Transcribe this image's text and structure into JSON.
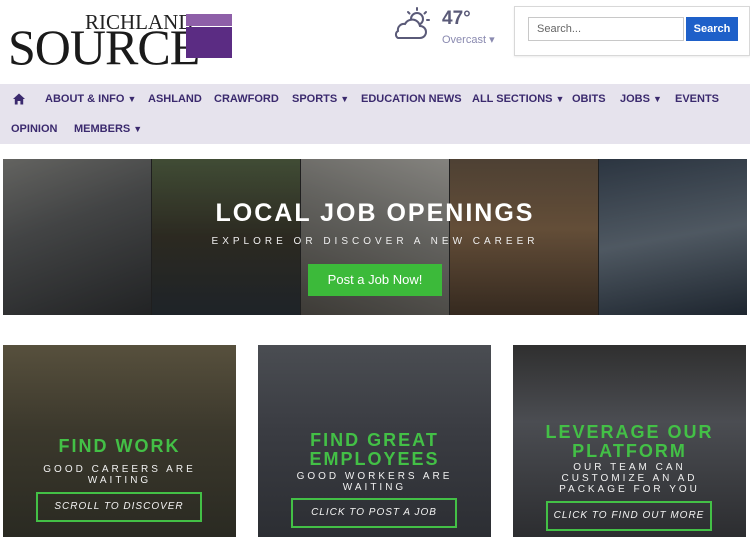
{
  "header": {
    "logo_top": "RICHLAND",
    "logo_main": "SOURCE",
    "weather": {
      "temp": "47°",
      "condition": "Overcast ▾",
      "icon": "partly-cloudy-icon"
    },
    "search": {
      "placeholder": "Search...",
      "button_label": "Search"
    }
  },
  "nav": {
    "items": [
      {
        "label": "ABOUT & INFO",
        "caret": "▼"
      },
      {
        "label": "ASHLAND"
      },
      {
        "label": "CRAWFORD"
      },
      {
        "label": "SPORTS",
        "caret": "▼"
      },
      {
        "label": "EDUCATION NEWS"
      },
      {
        "label": "ALL SECTIONS",
        "caret": "▼"
      },
      {
        "label": "OBITS"
      },
      {
        "label": "JOBS",
        "caret": "▼"
      },
      {
        "label": "EVENTS"
      },
      {
        "label": "OPINION"
      },
      {
        "label": "MEMBERS",
        "caret": "▼"
      }
    ]
  },
  "banner": {
    "title": "LOCAL JOB OPENINGS",
    "subtitle": "EXPLORE OR DISCOVER A NEW CAREER",
    "button_label": "Post a Job Now!"
  },
  "cards": [
    {
      "title_lines": [
        "FIND WORK"
      ],
      "subtitle_lines": [
        "GOOD CAREERS ARE",
        "WAITING"
      ],
      "button_label": "SCROLL TO DISCOVER"
    },
    {
      "title_lines": [
        "FIND GREAT",
        "EMPLOYEES"
      ],
      "subtitle_lines": [
        "GOOD WORKERS ARE",
        "WAITING"
      ],
      "button_label": "CLICK TO POST A JOB"
    },
    {
      "title_lines": [
        "LEVERAGE OUR",
        "PLATFORM"
      ],
      "subtitle_lines": [
        "OUR TEAM CAN",
        "CUSTOMIZE AN AD",
        "PACKAGE FOR YOU"
      ],
      "button_label": "CLICK TO FIND OUT MORE"
    }
  ],
  "colors": {
    "nav_bg": "#e6e3ed",
    "nav_text": "#3b2a6e",
    "accent_green": "#43c046",
    "search_blue": "#1e60c9",
    "logo_purple": "#5b2c83"
  }
}
